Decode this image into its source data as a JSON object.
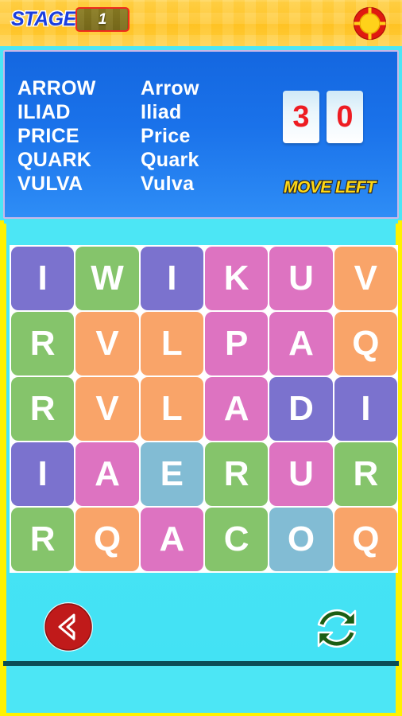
{
  "topbar": {
    "stage_label": "STAGE",
    "stage_number": "1",
    "help_icon": "life-ring-help-icon"
  },
  "word_panel": {
    "words": [
      {
        "upper": "ARROW",
        "title": "Arrow"
      },
      {
        "upper": "ILIAD",
        "title": "Iliad"
      },
      {
        "upper": "PRICE",
        "title": "Price"
      },
      {
        "upper": "QUARK",
        "title": "Quark"
      },
      {
        "upper": "VULVA",
        "title": "Vulva"
      }
    ],
    "score_digits": [
      "3",
      "0"
    ],
    "move_left_label": "MOVE LEFT"
  },
  "grid": {
    "rows": 5,
    "cols": 6,
    "tiles": [
      {
        "letter": "I",
        "color": "#7b72ce"
      },
      {
        "letter": "W",
        "color": "#85c46b"
      },
      {
        "letter": "I",
        "color": "#7b72ce"
      },
      {
        "letter": "K",
        "color": "#dd73c1"
      },
      {
        "letter": "U",
        "color": "#dd73c1"
      },
      {
        "letter": "V",
        "color": "#f9a469"
      },
      {
        "letter": "R",
        "color": "#85c46b"
      },
      {
        "letter": "V",
        "color": "#f9a469"
      },
      {
        "letter": "L",
        "color": "#f9a469"
      },
      {
        "letter": "P",
        "color": "#dd73c1"
      },
      {
        "letter": "A",
        "color": "#dd73c1"
      },
      {
        "letter": "Q",
        "color": "#f9a469"
      },
      {
        "letter": "R",
        "color": "#85c46b"
      },
      {
        "letter": "V",
        "color": "#f9a469"
      },
      {
        "letter": "L",
        "color": "#f9a469"
      },
      {
        "letter": "A",
        "color": "#dd73c1"
      },
      {
        "letter": "D",
        "color": "#7b72ce"
      },
      {
        "letter": "I",
        "color": "#7b72ce"
      },
      {
        "letter": "I",
        "color": "#7b72ce"
      },
      {
        "letter": "A",
        "color": "#dd73c1"
      },
      {
        "letter": "E",
        "color": "#82bcd4"
      },
      {
        "letter": "R",
        "color": "#85c46b"
      },
      {
        "letter": "U",
        "color": "#dd73c1"
      },
      {
        "letter": "R",
        "color": "#85c46b"
      },
      {
        "letter": "R",
        "color": "#85c46b"
      },
      {
        "letter": "Q",
        "color": "#f9a469"
      },
      {
        "letter": "A",
        "color": "#dd73c1"
      },
      {
        "letter": "C",
        "color": "#85c46b"
      },
      {
        "letter": "O",
        "color": "#82bcd4"
      },
      {
        "letter": "Q",
        "color": "#f9a469"
      }
    ]
  },
  "controls": {
    "back_icon": "back-chevron-icon",
    "refresh_icon": "refresh-shuffle-icon"
  },
  "colors": {
    "topbar_yellow": "#ffc423",
    "panel_blue": "#1a72ea",
    "play_cyan": "#4ce6f5",
    "frame_yellow": "#fff200",
    "score_red": "#ee1c22",
    "move_left_yellow": "#ffd814",
    "back_red": "#c01a1a",
    "refresh_green": "#1b5e14",
    "divider_teal": "#0b4d56"
  }
}
